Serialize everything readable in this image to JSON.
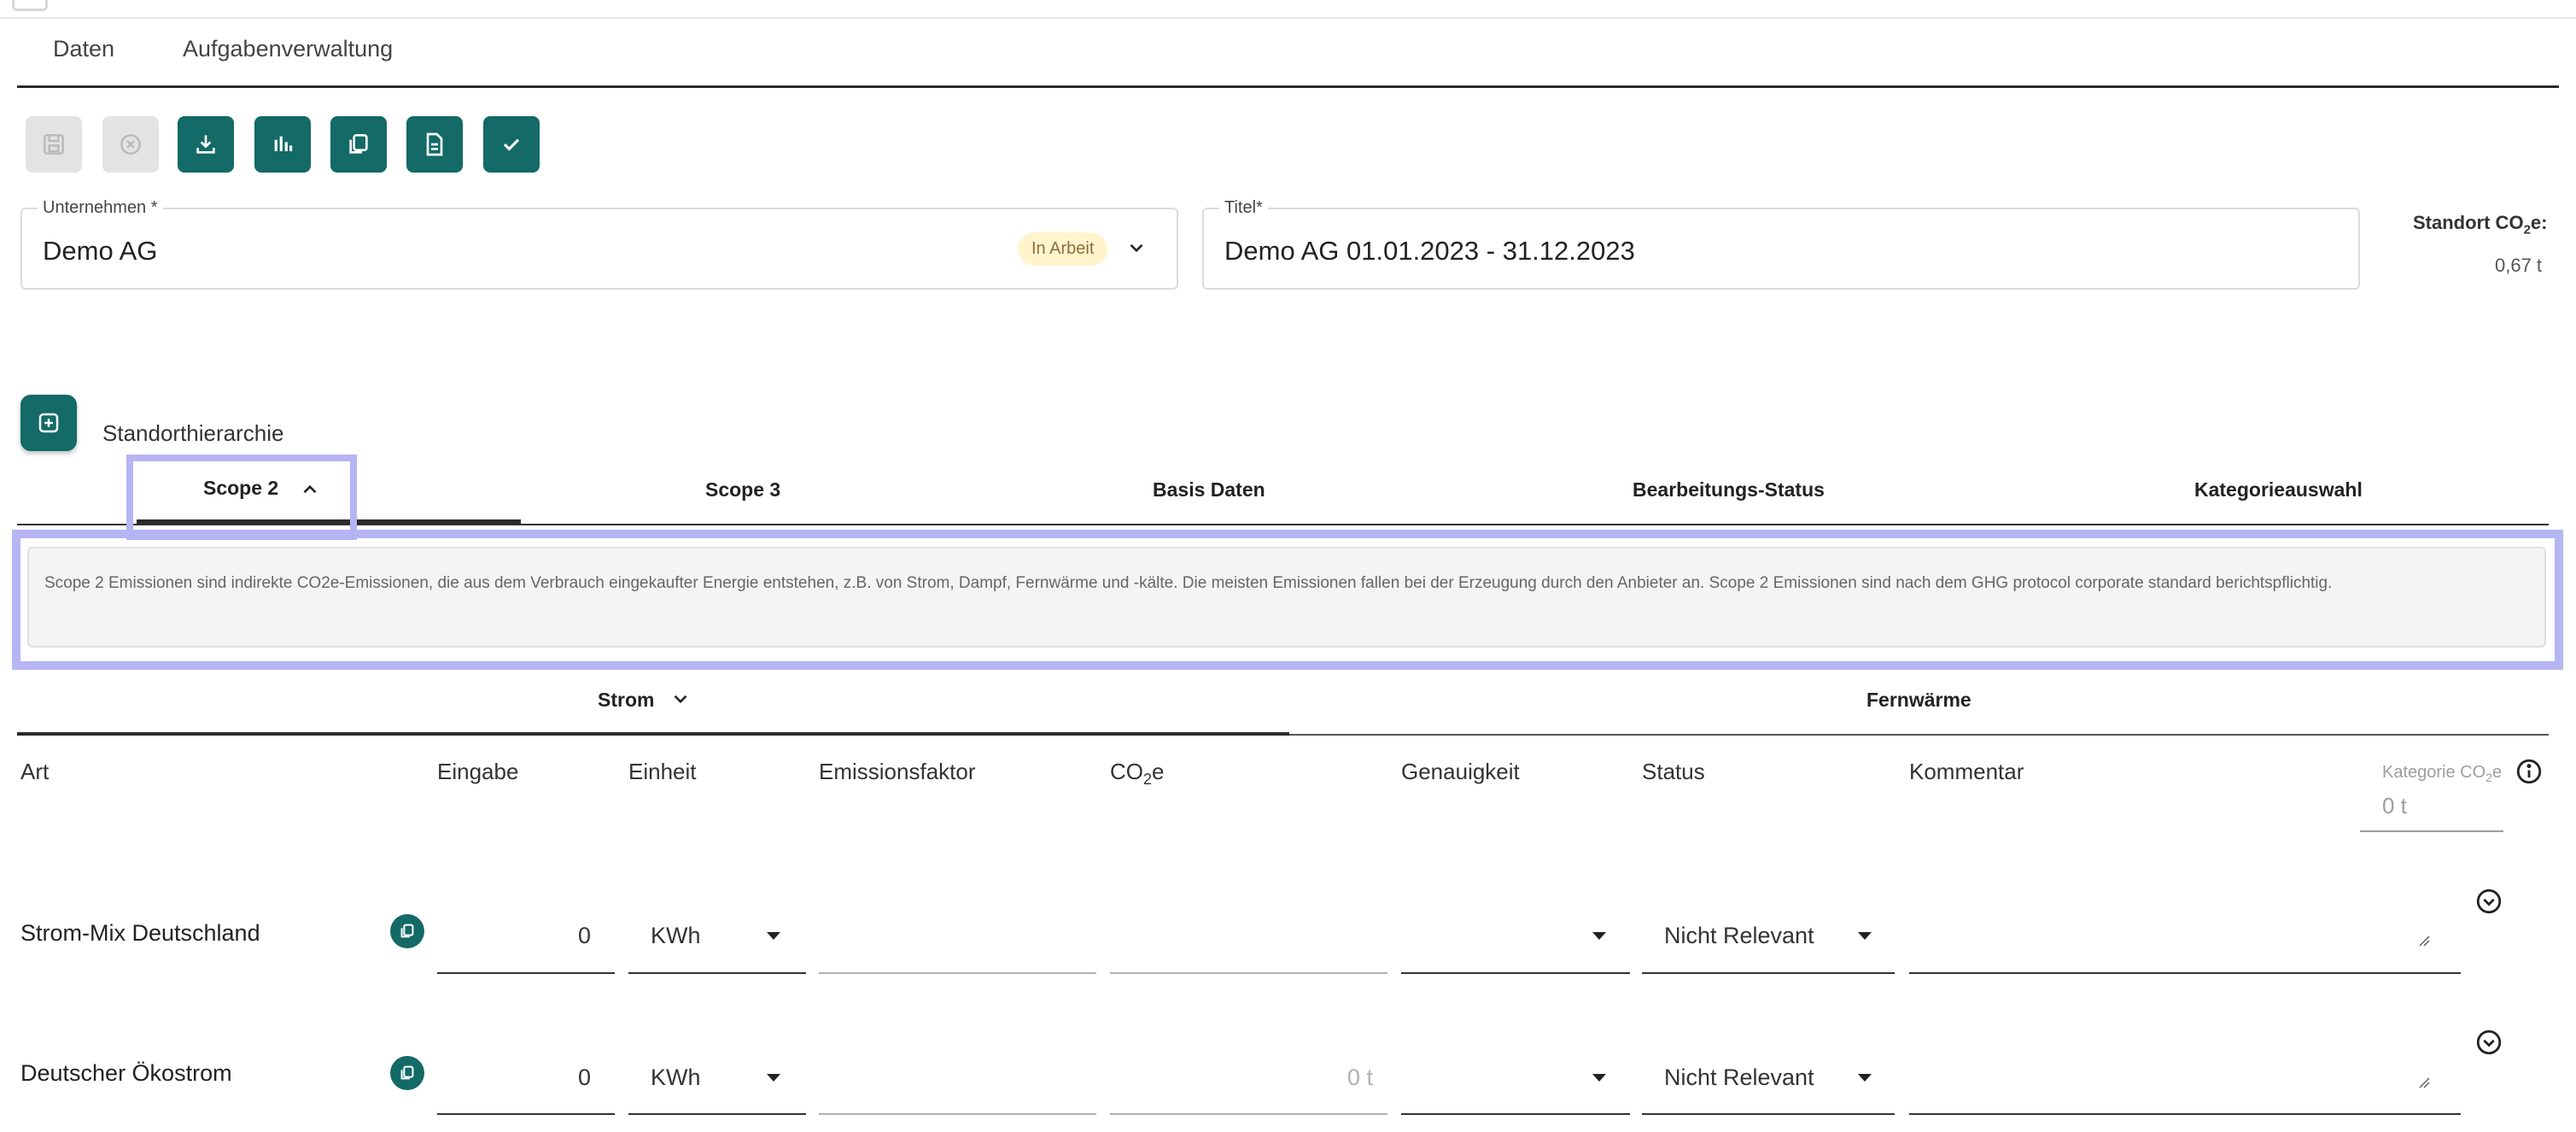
{
  "nav": {
    "tabs": [
      "Daten",
      "Aufgabenverwaltung"
    ]
  },
  "toolbar": {
    "buttons": [
      "save-icon",
      "cancel-icon",
      "download-icon",
      "chart-icon",
      "copy-icon",
      "document-icon",
      "check-icon"
    ],
    "accent": "#136a66"
  },
  "company": {
    "label": "Unternehmen *",
    "value": "Demo AG",
    "status": "In Arbeit"
  },
  "title": {
    "label": "Titel*",
    "value": "Demo AG 01.01.2023 - 31.12.2023"
  },
  "site_co2": {
    "label_pre": "Standort CO",
    "label_sub": "2",
    "label_post": "e:",
    "value": "0,67 t"
  },
  "hierarchy": {
    "label": "Standorthierarchie"
  },
  "scope_tabs": [
    "Scope 2",
    "Scope 3",
    "Basis Daten",
    "Bearbeitungs-Status",
    "Kategorieauswahl"
  ],
  "description": "Scope 2 Emissionen sind indirekte CO2e-Emissionen, die aus dem Verbrauch eingekaufter Energie entstehen, z.B. von Strom, Dampf, Fernwärme und -kälte. Die meisten Emissionen fallen bei der Erzeugung durch den Anbieter an. Scope 2 Emissionen sind nach dem GHG protocol corporate standard berichtspflichtig.",
  "sub_tabs": [
    "Strom",
    "Fernwärme"
  ],
  "table": {
    "headers": {
      "art": "Art",
      "eingabe": "Eingabe",
      "einheit": "Einheit",
      "faktor": "Emissionsfaktor",
      "co2_pre": "CO",
      "co2_sub": "2",
      "co2_post": "e",
      "genauigkeit": "Genauigkeit",
      "status": "Status",
      "kommentar": "Kommentar"
    },
    "category": {
      "label_pre": "Kategorie CO",
      "label_sub": "2",
      "label_post": "e",
      "value": "0 t"
    },
    "rows": [
      {
        "art": "Strom-Mix Deutschland",
        "eingabe": "0",
        "einheit": "KWh",
        "co2": "",
        "status": "Nicht Relevant"
      },
      {
        "art": "Deutscher Ökostrom",
        "eingabe": "0",
        "einheit": "KWh",
        "co2": "0 t",
        "status": "Nicht Relevant"
      }
    ]
  }
}
